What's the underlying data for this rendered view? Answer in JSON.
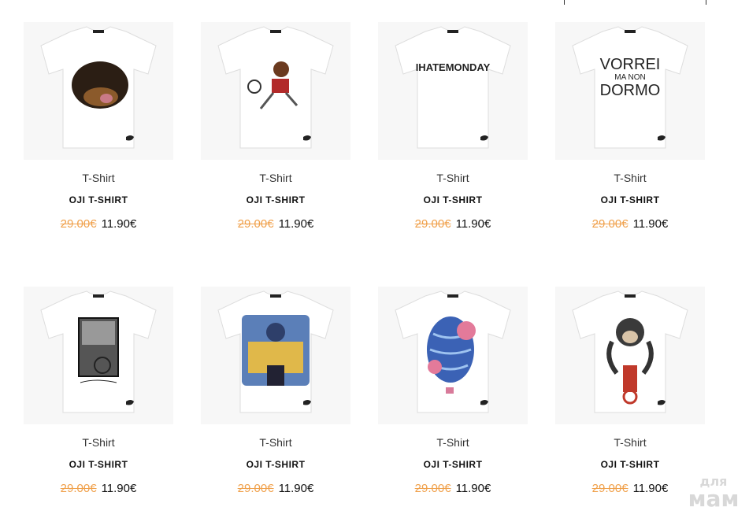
{
  "products": [
    {
      "category": "T-Shirt",
      "name": "OJI T-SHIRT",
      "old_price": "29.00€",
      "price": "11.90€",
      "print": "rottweiler-dog-print"
    },
    {
      "category": "T-Shirt",
      "name": "OJI T-SHIRT",
      "old_price": "29.00€",
      "price": "11.90€",
      "print": "tennis-cartoon-print"
    },
    {
      "category": "T-Shirt",
      "name": "OJI T-SHIRT",
      "old_price": "29.00€",
      "price": "11.90€",
      "print_text": "IHATEMONDAY",
      "print": "text-print"
    },
    {
      "category": "T-Shirt",
      "name": "OJI T-SHIRT",
      "old_price": "29.00€",
      "price": "11.90€",
      "print_text_1": "VORREI",
      "print_text_2": "MA NON",
      "print_text_3": "DORMO",
      "print": "text-print"
    },
    {
      "category": "T-Shirt",
      "name": "OJI T-SHIRT",
      "old_price": "29.00€",
      "price": "11.90€",
      "print": "amsterdam-photo-print"
    },
    {
      "category": "T-Shirt",
      "name": "OJI T-SHIRT",
      "old_price": "29.00€",
      "price": "11.90€",
      "print": "motorcycle-cartoon-print"
    },
    {
      "category": "T-Shirt",
      "name": "OJI T-SHIRT",
      "old_price": "29.00€",
      "price": "11.90€",
      "print": "hot-air-balloon-flowers-print"
    },
    {
      "category": "T-Shirt",
      "name": "OJI T-SHIRT",
      "old_price": "29.00€",
      "price": "11.90€",
      "print": "monkey-bicycle-print"
    }
  ],
  "watermark": {
    "line1": "для",
    "line2": "мам"
  },
  "colors": {
    "old_price": "#f0a04a",
    "text": "#111111",
    "bg": "#ffffff"
  }
}
